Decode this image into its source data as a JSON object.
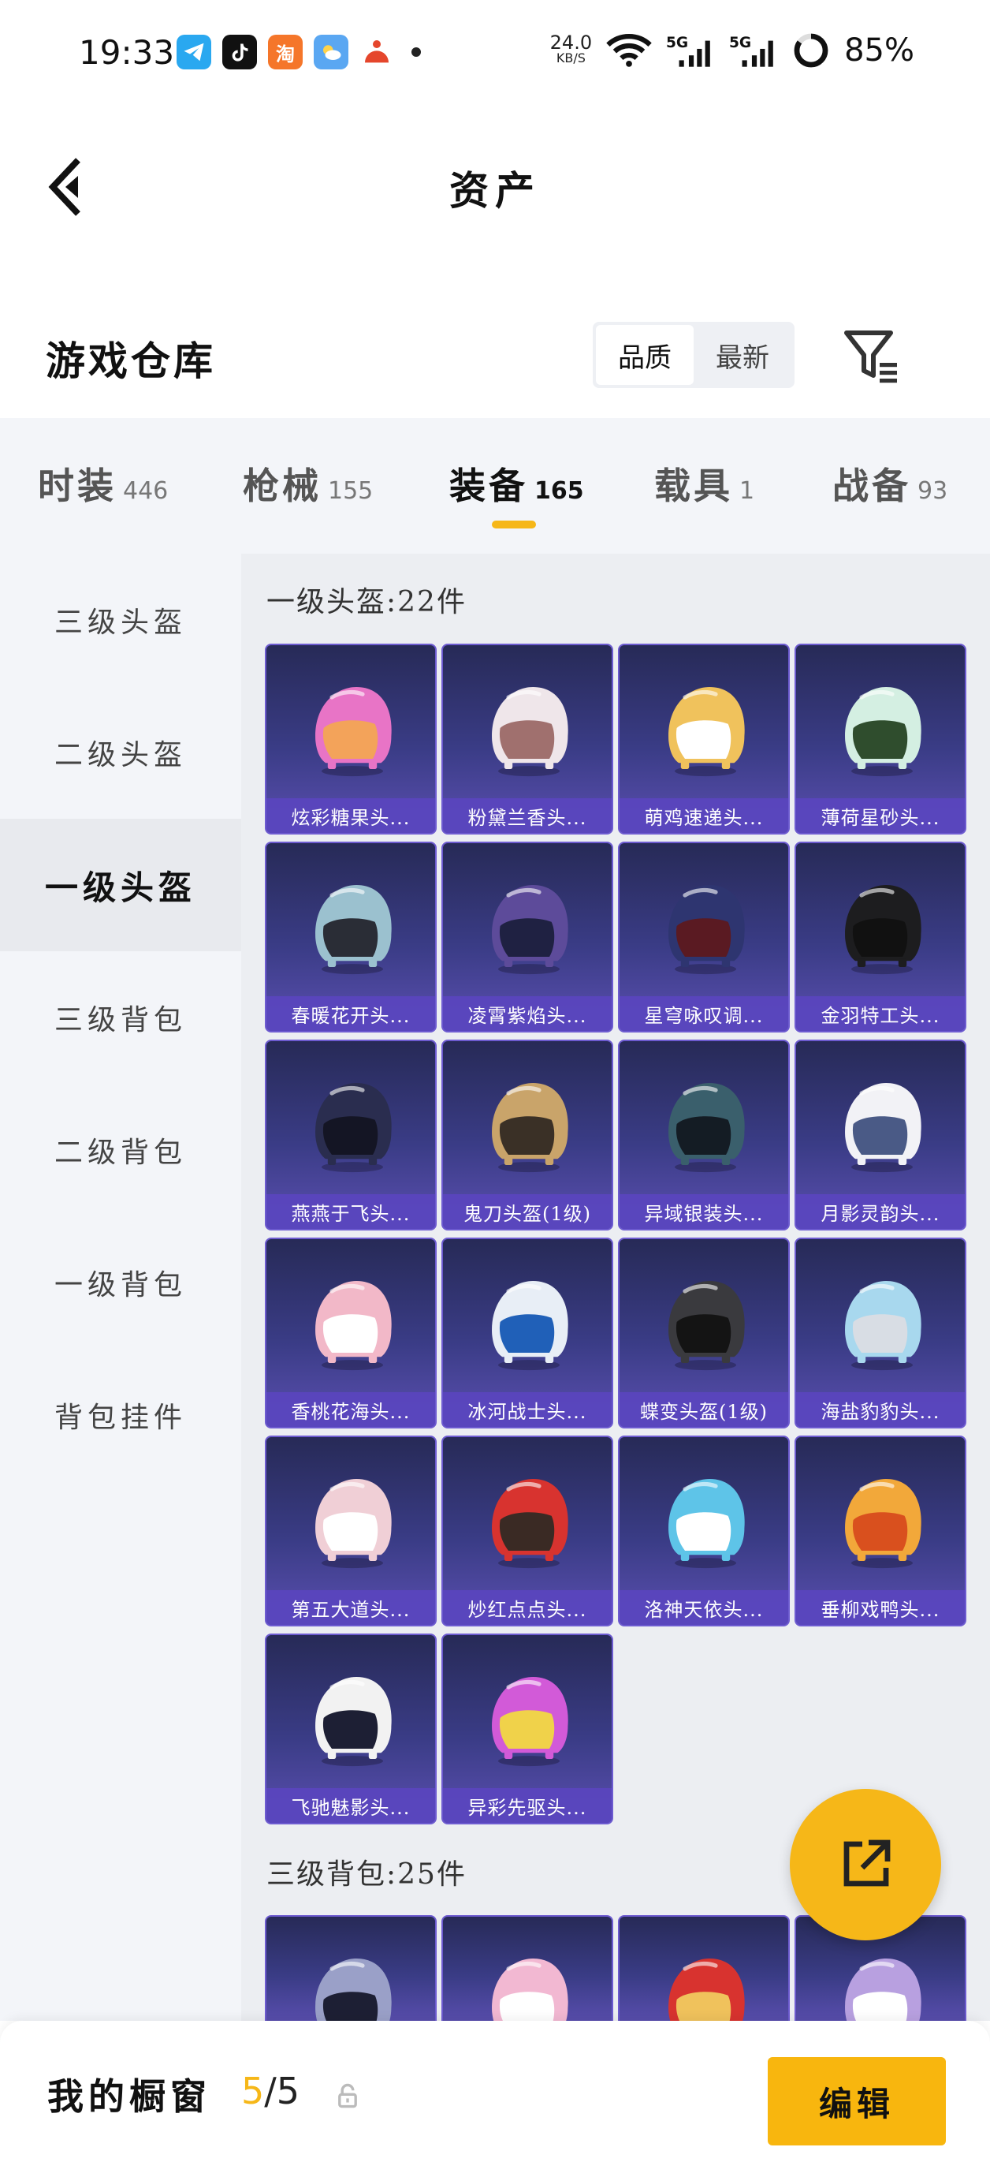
{
  "status_bar": {
    "time": "19:33",
    "net_speed_value": "24.0",
    "net_speed_unit": "KB/S",
    "battery": "85%",
    "app_icons": [
      "telegram-icon",
      "tiktok-icon",
      "taobao-icon",
      "weather-icon",
      "app-icon"
    ],
    "taobao_glyph": "淘"
  },
  "header": {
    "title": "资产"
  },
  "warehouse": {
    "title": "游戏仓库",
    "sort_options": [
      "品质",
      "最新"
    ],
    "sort_selected": "品质"
  },
  "tabs": [
    {
      "label": "时装",
      "count": "446"
    },
    {
      "label": "枪械",
      "count": "155"
    },
    {
      "label": "装备",
      "count": "165"
    },
    {
      "label": "载具",
      "count": "1"
    },
    {
      "label": "战备",
      "count": "93"
    }
  ],
  "active_tab": "装备",
  "sidebar": {
    "items": [
      {
        "label": "三级头盔"
      },
      {
        "label": "二级头盔"
      },
      {
        "label": "一级头盔"
      },
      {
        "label": "三级背包"
      },
      {
        "label": "二级背包"
      },
      {
        "label": "一级背包"
      },
      {
        "label": "背包挂件"
      }
    ],
    "active": "一级头盔"
  },
  "groups": [
    {
      "title": "一级头盔:22件",
      "items": [
        {
          "name": "炫彩糖果头...",
          "color": "#e874c6",
          "visor": "#f3a35a"
        },
        {
          "name": "粉黛兰香头...",
          "color": "#efe6ea",
          "visor": "#a0706e"
        },
        {
          "name": "萌鸡速递头...",
          "color": "#f0c25c",
          "visor": "#ffffff"
        },
        {
          "name": "薄荷星砂头...",
          "color": "#d4efe2",
          "visor": "#2f4d2d"
        },
        {
          "name": "春暖花开头...",
          "color": "#9bc1cf",
          "visor": "#2a2d36"
        },
        {
          "name": "凌霄紫焰头...",
          "color": "#5d4b9a",
          "visor": "#1f2142"
        },
        {
          "name": "星穹咏叹调...",
          "color": "#2e3570",
          "visor": "#5a1a22"
        },
        {
          "name": "金羽特工头...",
          "color": "#1d1d1f",
          "visor": "#111111"
        },
        {
          "name": "燕燕于飞头...",
          "color": "#2a2d4f",
          "visor": "#141524"
        },
        {
          "name": "鬼刀头盔(1级)",
          "color": "#c9a46a",
          "visor": "#3a3026"
        },
        {
          "name": "异域银装头...",
          "color": "#3a5f6c",
          "visor": "#141c24"
        },
        {
          "name": "月影灵韵头...",
          "color": "#f2f2f6",
          "visor": "#4a5a86"
        },
        {
          "name": "香桃花海头...",
          "color": "#f2b8c8",
          "visor": "#ffffff"
        },
        {
          "name": "冰河战士头...",
          "color": "#e8eef6",
          "visor": "#2060b8"
        },
        {
          "name": "蝶变头盔(1级)",
          "color": "#3a3a3e",
          "visor": "#141414"
        },
        {
          "name": "海盐豹豹头...",
          "color": "#a8d8ee",
          "visor": "#d8dde4"
        },
        {
          "name": "第五大道头...",
          "color": "#f0cfd6",
          "visor": "#ffffff"
        },
        {
          "name": "炒红点点头...",
          "color": "#d8332f",
          "visor": "#3a2a24"
        },
        {
          "name": "洛神天依头...",
          "color": "#5ec4e8",
          "visor": "#ffffff"
        },
        {
          "name": "垂柳戏鸭头...",
          "color": "#f2a83a",
          "visor": "#d9501e"
        },
        {
          "name": "飞驰魅影头...",
          "color": "#f2f2f2",
          "visor": "#1d1f34"
        },
        {
          "name": "异彩先驱头...",
          "color": "#d25ad8",
          "visor": "#f0d24a"
        }
      ]
    },
    {
      "title": "三级背包:25件",
      "items": [
        {
          "name": "",
          "color": "#9aa0c8",
          "visor": "#1d1f34"
        },
        {
          "name": "",
          "color": "#f2b8d2",
          "visor": "#ffffff"
        },
        {
          "name": "",
          "color": "#d8332f",
          "visor": "#f0c25c"
        },
        {
          "name": "",
          "color": "#b8a0e0",
          "visor": "#ffffff"
        }
      ]
    }
  ],
  "bottom_bar": {
    "label": "我的橱窗",
    "current": "5",
    "separator": "/",
    "total": "5",
    "edit_label": "编辑"
  },
  "colors": {
    "accent": "#f6b718",
    "card_top": "#272a57",
    "card_bottom": "#5b4fb0",
    "card_label_bg": "#5a46be"
  }
}
